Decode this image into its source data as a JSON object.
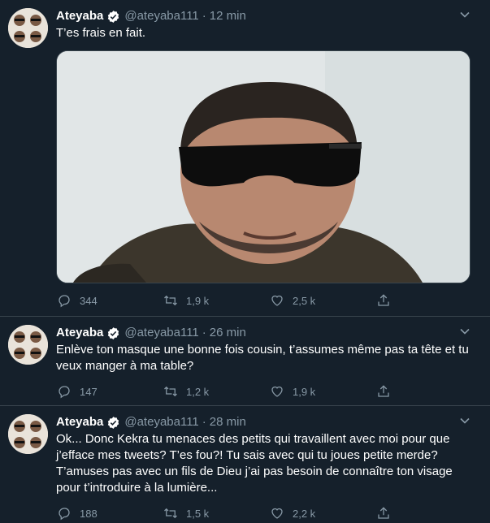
{
  "tweets": [
    {
      "name": "Ateyaba",
      "handle": "@ateyaba111",
      "separator": "·",
      "time": "12 min",
      "text": "T’es frais en fait.",
      "replies": "344",
      "retweets": "1,9 k",
      "likes": "2,5 k"
    },
    {
      "name": "Ateyaba",
      "handle": "@ateyaba111",
      "separator": "·",
      "time": "26 min",
      "text": "Enlève ton masque une bonne fois cousin, t’assumes même pas ta tête et tu veux manger à ma table?",
      "replies": "147",
      "retweets": "1,2 k",
      "likes": "1,9 k"
    },
    {
      "name": "Ateyaba",
      "handle": "@ateyaba111",
      "separator": "·",
      "time": "28 min",
      "text": "Ok... Donc Kekra tu menaces des petits qui travaillent avec moi pour que j’efface mes tweets? T’es fou?! Tu sais avec qui tu joues petite merde? T’amuses pas avec un fils de Dieu j’ai pas besoin de connaître ton visage pour t’introduire à la lumière...",
      "replies": "188",
      "retweets": "1,5 k",
      "likes": "2,2 k"
    }
  ],
  "icons": {
    "reply": "reply-icon",
    "retweet": "retweet-icon",
    "like": "like-icon",
    "share": "share-icon",
    "verified": "verified-badge-icon",
    "caret": "chevron-down-icon"
  },
  "colors": {
    "background": "#15202b",
    "border": "#38444d",
    "secondary_text": "#8899a6",
    "primary_text": "#ffffff"
  }
}
